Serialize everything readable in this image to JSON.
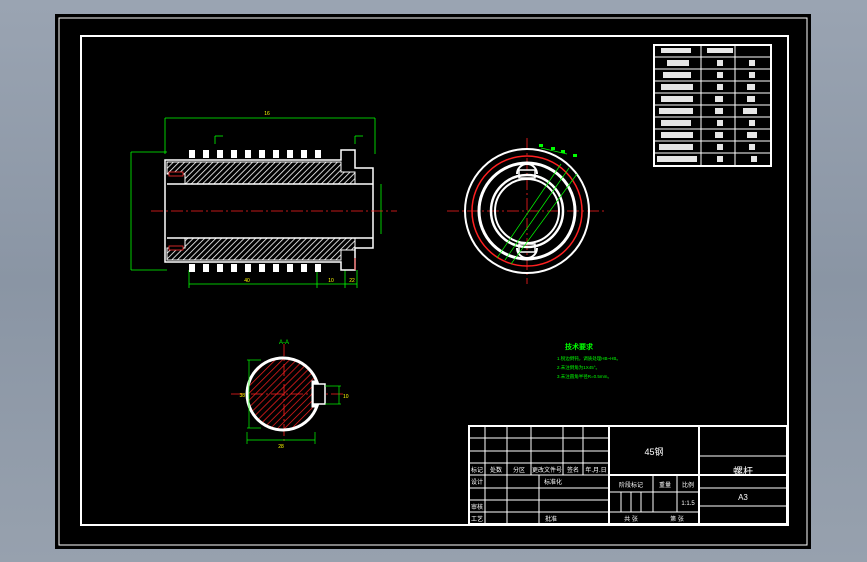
{
  "title_block": {
    "part_name": "螺杆",
    "material": "45钢",
    "sheet_size": "A3",
    "scale": "1:1.5",
    "headers": [
      "标记",
      "处数",
      "分区",
      "更改文件号",
      "签名",
      "年.月.日"
    ],
    "design": "设计",
    "standardize": "标准化",
    "review": "审核",
    "process": "工艺",
    "approve": "批准",
    "stage_mark": "阶段标记",
    "weight": "重量",
    "scale_label": "比例",
    "total_sheets": "共 张",
    "sheet_no": "第 张"
  },
  "tech_req": {
    "title": "技术要求",
    "items": [
      "1.锐边倒钝，调质处理HB~HB。",
      "2.未注倒角为1X45°。",
      "3.未注圆角半径R=0.5mm。"
    ]
  },
  "section_label": "A-A",
  "dims": {
    "overall_length": "16",
    "left_bottom": "40",
    "mid_bottom": "10",
    "right_bottom": "22",
    "section_width": "28",
    "section_height": "38",
    "key_width": "10"
  },
  "param_table": {
    "rows": 9
  }
}
